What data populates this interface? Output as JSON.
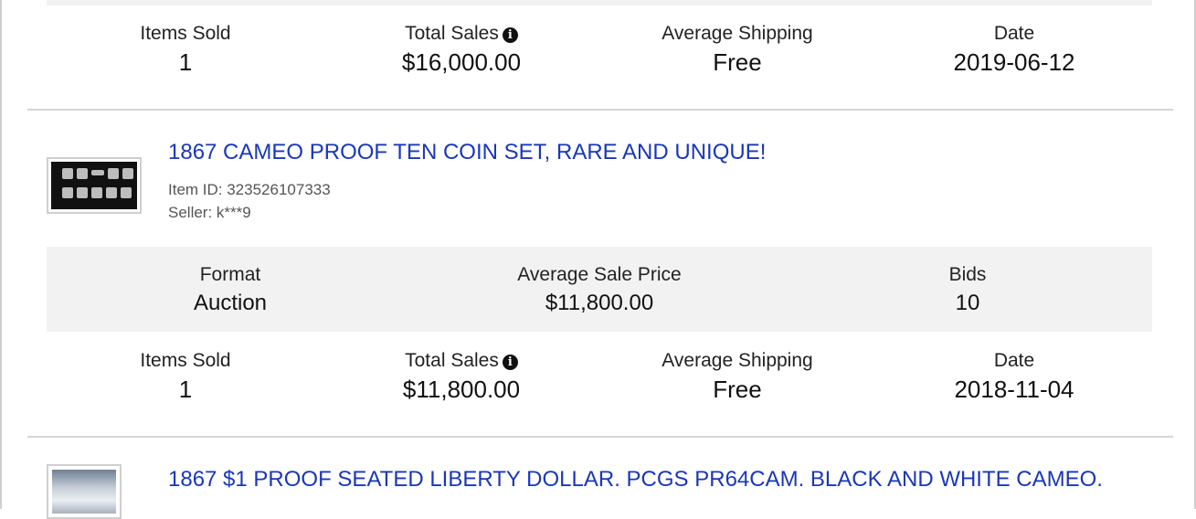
{
  "stat_labels": {
    "items_sold": "Items Sold",
    "total_sales": "Total Sales",
    "average_shipping": "Average Shipping",
    "date": "Date",
    "format": "Format",
    "average_sale_price": "Average Sale Price",
    "bids": "Bids"
  },
  "items": [
    {
      "items_sold": "1",
      "total_sales": "$16,000.00",
      "average_shipping": "Free",
      "date": "2019-06-12"
    },
    {
      "title": "1867 CAMEO PROOF TEN COIN SET, RARE AND UNIQUE!",
      "item_id": "Item ID: 323526107333",
      "seller": "Seller: k***9",
      "format": "Auction",
      "average_sale_price": "$11,800.00",
      "bids": "10",
      "items_sold": "1",
      "total_sales": "$11,800.00",
      "average_shipping": "Free",
      "date": "2018-11-04"
    },
    {
      "title": "1867 $1 PROOF SEATED LIBERTY DOLLAR. PCGS PR64CAM. BLACK AND WHITE CAMEO."
    }
  ],
  "icons": {
    "info": "info-icon"
  }
}
